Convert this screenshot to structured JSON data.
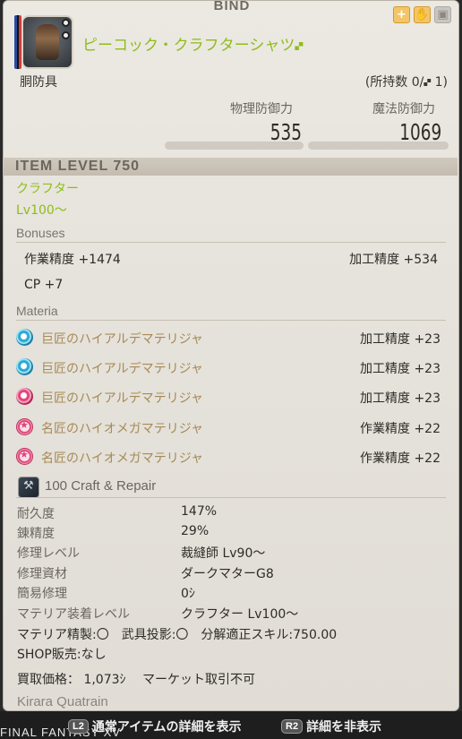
{
  "header": {
    "bind_label": "BIND",
    "icons": [
      "plus-icon",
      "hand-icon",
      "image-icon"
    ]
  },
  "item": {
    "name": "ピーコック・クラフターシャツ",
    "hq_symbol": "🙾",
    "category": "胴防具",
    "owned_label": "(所持数 0/",
    "owned_hq": "🙾",
    "owned_tail": " 1)"
  },
  "stats": {
    "phys_label": "物理防御力",
    "phys_value": "535",
    "magic_label": "魔法防御力",
    "magic_value": "1069"
  },
  "item_level": "ITEM LEVEL 750",
  "job": "クラフター",
  "level_req": "Lv100～",
  "bonuses": {
    "title": "Bonuses",
    "craftsmanship": "作業精度 +1474",
    "control": "加工精度 +534",
    "cp": "CP +7"
  },
  "materia": {
    "title": "Materia",
    "items": [
      {
        "name": "巨匠のハイアルデマテリジャ",
        "stat": "加工精度 +23",
        "color": "cyan"
      },
      {
        "name": "巨匠のハイアルデマテリジャ",
        "stat": "加工精度 +23",
        "color": "cyan"
      },
      {
        "name": "巨匠のハイアルデマテリジャ",
        "stat": "加工精度 +23",
        "color": "pink"
      },
      {
        "name": "名匠のハイオメガマテリジャ",
        "stat": "作業精度 +22",
        "color": "star"
      },
      {
        "name": "名匠のハイオメガマテリジャ",
        "stat": "作業精度 +22",
        "color": "star"
      }
    ]
  },
  "craft": {
    "title": "100 Craft & Repair",
    "rows": [
      {
        "k": "耐久度",
        "v": "147%"
      },
      {
        "k": "錬精度",
        "v": "29%"
      },
      {
        "k": "修理レベル",
        "v": "裁縫師 Lv90～"
      },
      {
        "k": "修理資材",
        "v": "ダークマターG8"
      },
      {
        "k": "簡易修理",
        "v": "0ｼ"
      },
      {
        "k": "マテリア装着レベル",
        "v": "クラフター Lv100～"
      }
    ],
    "flags": "マテリア精製:〇　武具投影:〇　分解適正スキル:750.00",
    "shop": "SHOP販売:なし",
    "price": "買取価格：  1,073ｼ　 マーケット取引不可"
  },
  "author": "Kirara Quatrain",
  "footer": {
    "game_title": "FINAL FANTASY XV",
    "hint1_key": "L2",
    "hint1_label": "通常アイテムの詳細を表示",
    "hint2_key": "R2",
    "hint2_label": "詳細を非表示"
  },
  "colors": {
    "name_green": "#8fbc1a",
    "materia_text": "#a68a55"
  }
}
